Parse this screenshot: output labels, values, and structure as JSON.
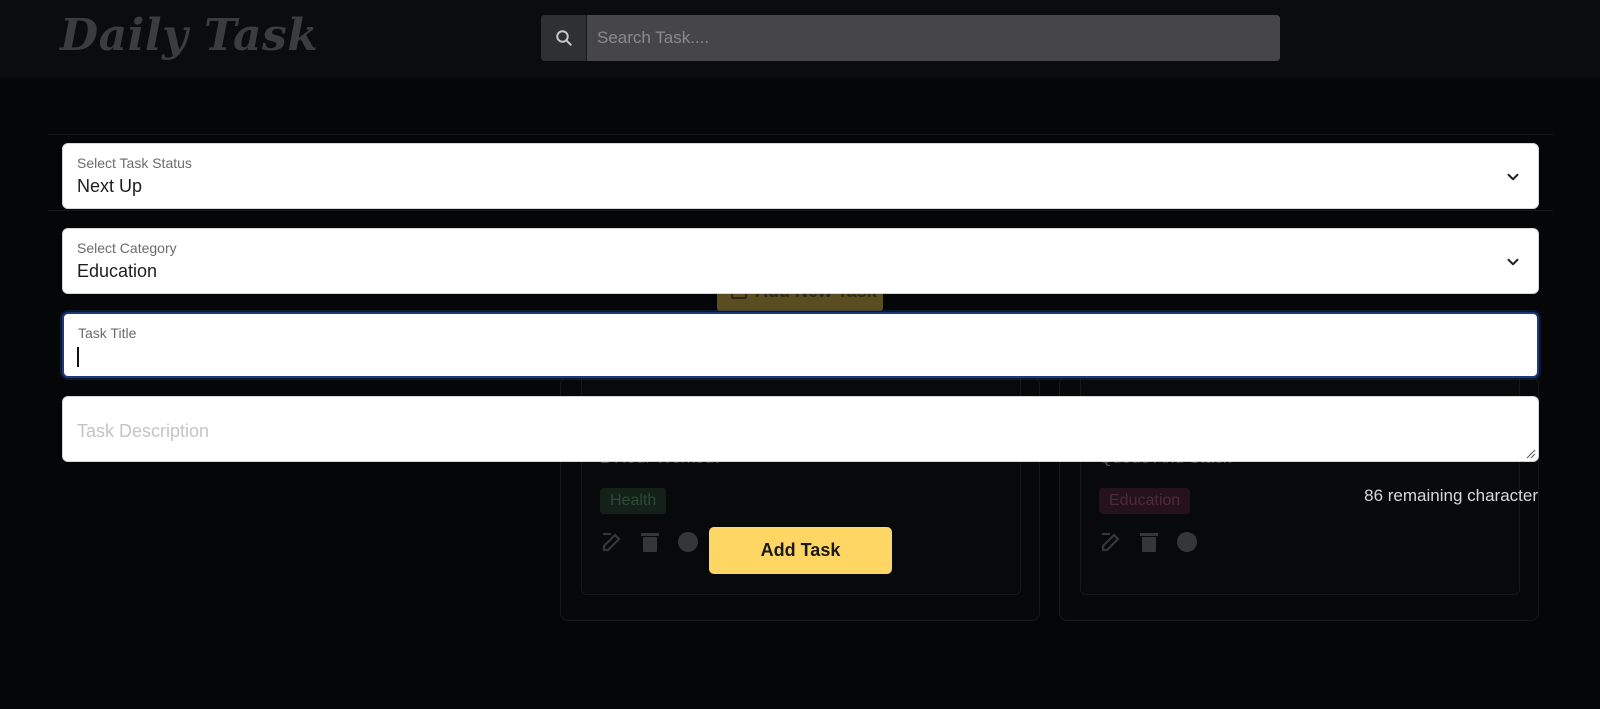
{
  "app": {
    "logo": "Daily Task"
  },
  "search": {
    "placeholder": "Search Task....",
    "icon": "search-icon"
  },
  "background": {
    "add_new_task_label": "Add New Task",
    "cards": [
      {
        "title": "1 Hour Workout",
        "tag": "Health",
        "tag_color": "#142118"
      },
      {
        "title": "Queue And Stack",
        "tag": "Education",
        "tag_color": "#25121a"
      }
    ],
    "card_actions": [
      "edit-icon",
      "trash-icon",
      "palette-icon"
    ]
  },
  "form": {
    "status": {
      "label": "Select Task Status",
      "value": "Next Up"
    },
    "category": {
      "label": "Select Category",
      "value": "Education"
    },
    "title": {
      "label": "Task Title",
      "value": ""
    },
    "description": {
      "placeholder": "Task Description"
    },
    "remaining": "86 remaining character",
    "submit_label": "Add Task"
  },
  "colors": {
    "accent": "#fdd663",
    "focus": "#1c3a78",
    "background": "#050608"
  }
}
